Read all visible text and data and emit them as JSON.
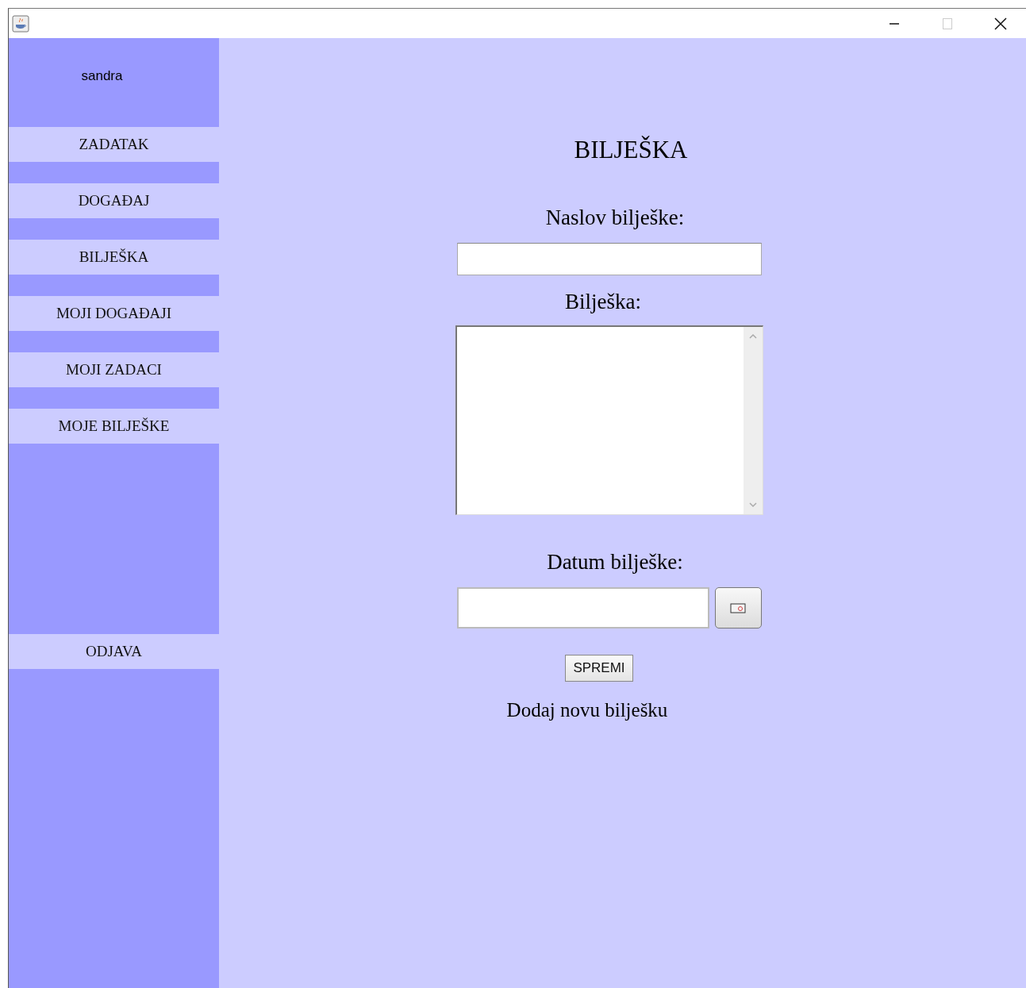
{
  "window": {
    "controls": [
      {
        "kind": "minimize"
      },
      {
        "kind": "maximize"
      },
      {
        "kind": "close"
      }
    ]
  },
  "sidebar": {
    "user": "sandra",
    "items": [
      {
        "label": "ZADATAK"
      },
      {
        "label": "DOGAĐAJ"
      },
      {
        "label": "BILJEŠKA"
      },
      {
        "label": "MOJI DOGAĐAJI"
      },
      {
        "label": "MOJI ZADACI"
      },
      {
        "label": "MOJE BILJEŠKE"
      }
    ],
    "logout_button": "ODJAVA"
  },
  "form": {
    "title": "BILJEŠKA",
    "title_label": "Naslov bilješke:",
    "note_label": "Bilješka:",
    "date_label": "Datum bilješke:",
    "save_button": "SPREMI",
    "status": "Dodaj novu bilješku"
  }
}
